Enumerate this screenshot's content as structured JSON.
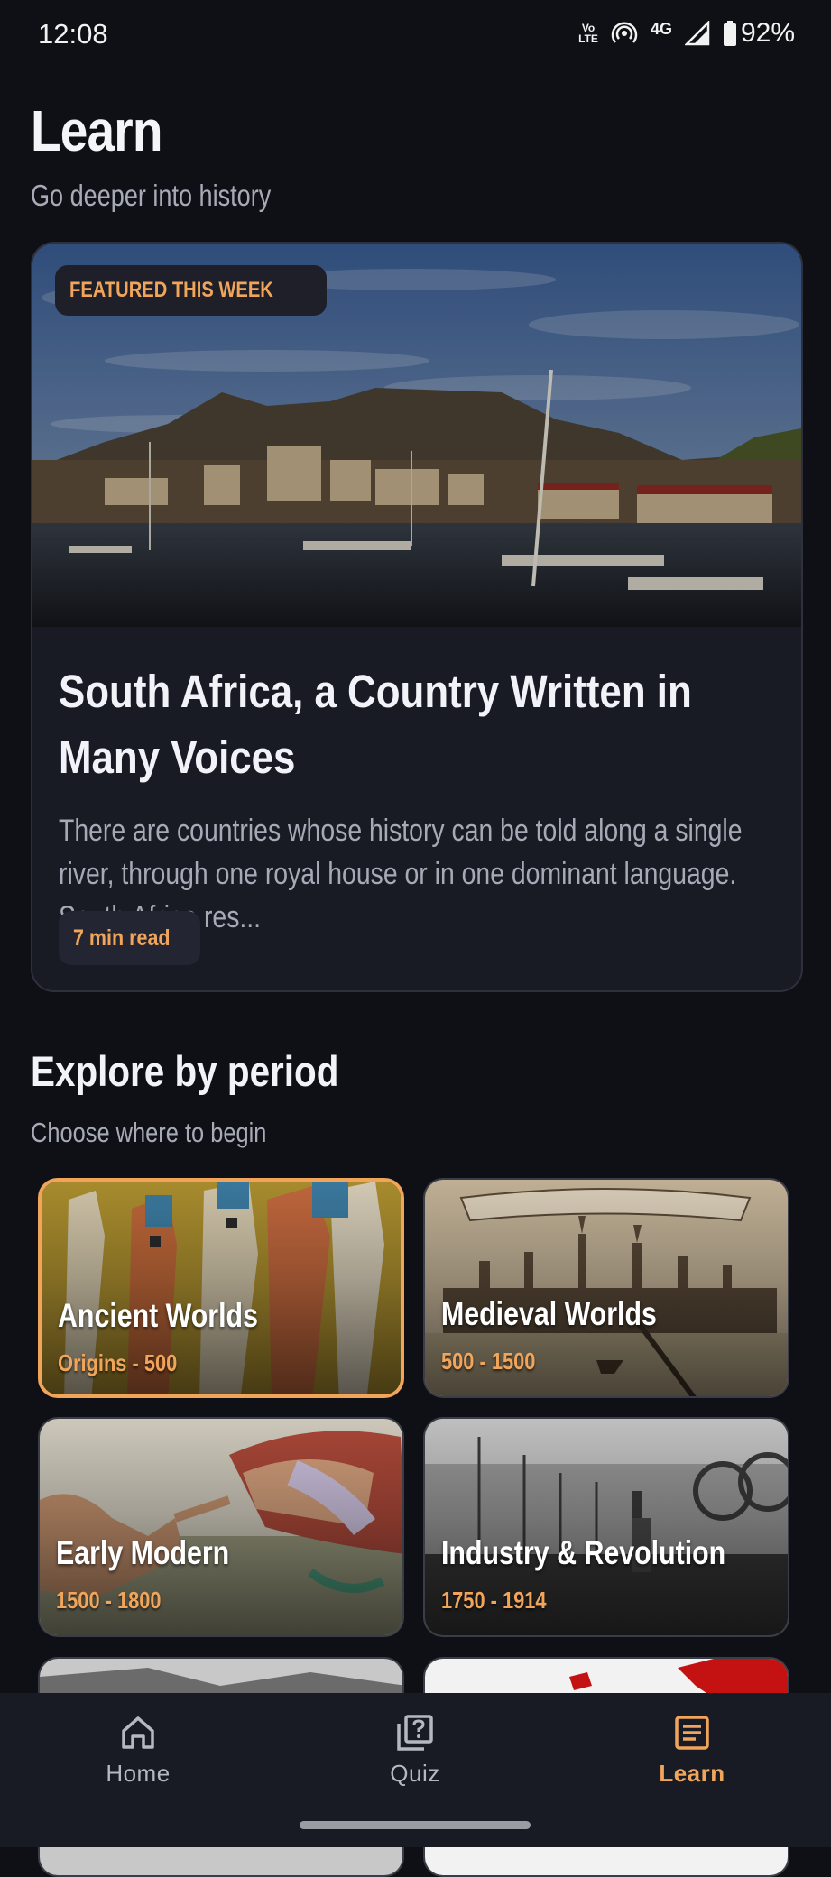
{
  "status_bar": {
    "time": "12:08",
    "volte_top": "Vo",
    "volte_bottom": "LTE",
    "network": "4G",
    "battery": "92%"
  },
  "header": {
    "title": "Learn",
    "subtitle": "Go deeper into history"
  },
  "featured": {
    "badge": "FEATURED THIS WEEK",
    "title": "South Africa, a Country Written in Many Voices",
    "excerpt": "There are countries whose history can be told along a single river, through one royal house or in one dominant language. South Africa res...",
    "read_time": "7 min read"
  },
  "explore": {
    "title": "Explore by period",
    "subtitle": "Choose where to begin",
    "periods": [
      {
        "name": "Ancient Worlds",
        "range": "Origins - 500",
        "selected": true
      },
      {
        "name": "Medieval Worlds",
        "range": "500 - 1500",
        "selected": false
      },
      {
        "name": "Early Modern",
        "range": "1500 - 1800",
        "selected": false
      },
      {
        "name": "Industry & Revolution",
        "range": "1750 - 1914",
        "selected": false
      }
    ]
  },
  "nav": {
    "items": [
      {
        "label": "Home",
        "icon": "home-icon"
      },
      {
        "label": "Quiz",
        "icon": "quiz-icon"
      },
      {
        "label": "Learn",
        "icon": "article-icon"
      }
    ],
    "active": "Learn",
    "accent": "#f0a55a"
  }
}
